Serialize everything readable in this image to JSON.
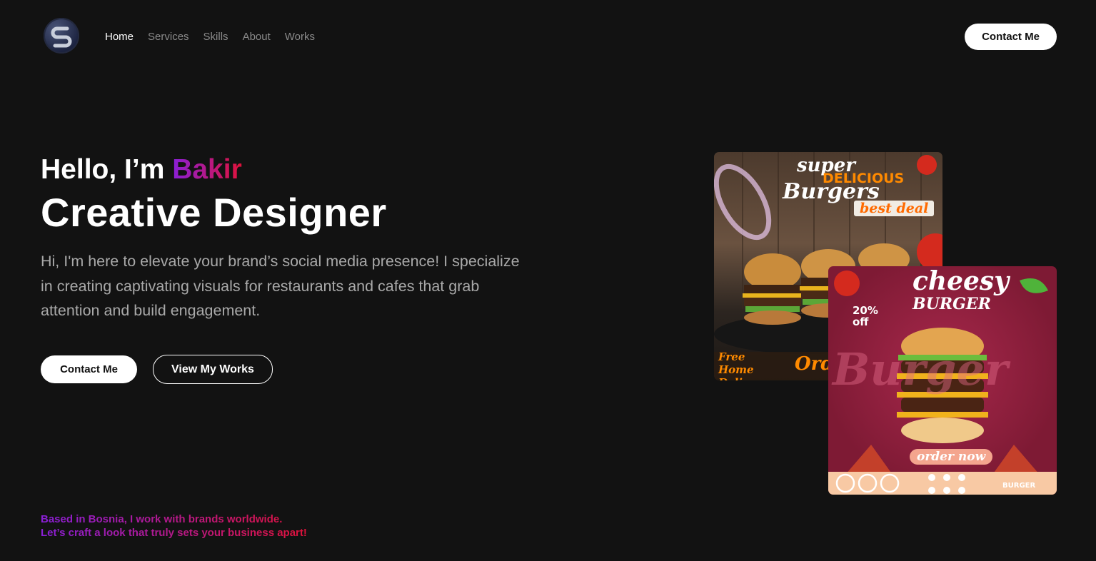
{
  "nav": {
    "logo_icon": "s-logo-icon",
    "items": [
      {
        "label": "Home",
        "active": true
      },
      {
        "label": "Services",
        "active": false
      },
      {
        "label": "Skills",
        "active": false
      },
      {
        "label": "About",
        "active": false
      },
      {
        "label": "Works",
        "active": false
      }
    ],
    "contact_label": "Contact Me"
  },
  "hero": {
    "greeting_prefix": "Hello, I’m ",
    "greeting_name": "Bakir",
    "title": "Creative Designer",
    "description": "Hi, I'm here to elevate your brand’s social media presence! I specialize in creating captivating visuals for restaurants and cafes that grab attention and build engagement.",
    "contact_label": "Contact Me",
    "works_label": "View My Works"
  },
  "footer_note": {
    "line1": "Based in Bosnia, I work with brands worldwide.",
    "line2": "Let’s craft a look that truly sets your business apart!"
  },
  "portfolio": {
    "card1": {
      "line1": "super",
      "line2": "DELICIOUS",
      "line3": "Burgers",
      "badge": "best deal",
      "footer_left": "Free Home Delivery",
      "footer_right": "Orde"
    },
    "card2": {
      "line1": "cheesy",
      "line2": "BURGER",
      "discount": "20% off",
      "watermark": "Burger",
      "cta": "order now",
      "brand": "BURGER"
    }
  },
  "colors": {
    "background": "#121212",
    "gradient_start": "#8a1fd8",
    "gradient_end": "#e0123a",
    "muted_text": "#a9a9a9"
  }
}
